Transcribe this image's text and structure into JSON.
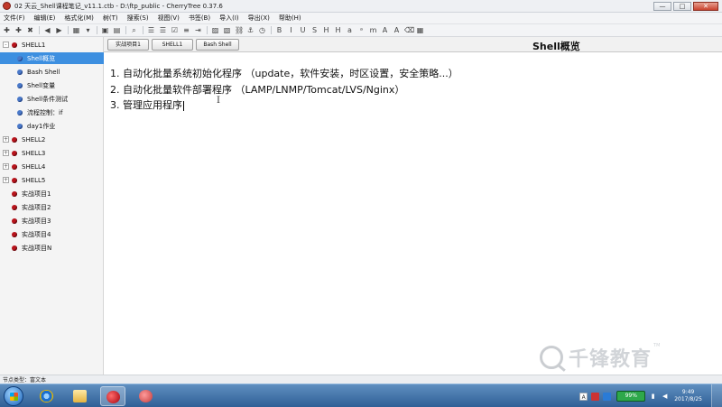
{
  "window": {
    "title": "02 天云_Shell课程笔记_v11.1.ctb - D:\\ftp_public - CherryTree 0.37.6",
    "controls": {
      "minimize": "—",
      "maximize": "□",
      "close": "✕"
    }
  },
  "menu": [
    "文件(F)",
    "编辑(E)",
    "格式化(M)",
    "树(T)",
    "搜索(S)",
    "视图(V)",
    "书签(B)",
    "导入(I)",
    "导出(X)",
    "帮助(H)"
  ],
  "tree": {
    "items": [
      {
        "label": "SHELL1",
        "level": 0,
        "expander": "-",
        "dot": "red"
      },
      {
        "label": "Shell概览",
        "level": 1,
        "dot": "blue",
        "selected": true
      },
      {
        "label": "Bash Shell",
        "level": 1,
        "dot": "blue"
      },
      {
        "label": "Shell变量",
        "level": 1,
        "dot": "blue"
      },
      {
        "label": "Shell条件测试",
        "level": 1,
        "dot": "blue"
      },
      {
        "label": "流程控制：if",
        "level": 1,
        "dot": "blue"
      },
      {
        "label": "day1作业",
        "level": 1,
        "dot": "blue"
      },
      {
        "label": "SHELL2",
        "level": 0,
        "expander": "+",
        "dot": "red"
      },
      {
        "label": "SHELL3",
        "level": 0,
        "expander": "+",
        "dot": "red"
      },
      {
        "label": "SHELL4",
        "level": 0,
        "expander": "+",
        "dot": "red"
      },
      {
        "label": "SHELL5",
        "level": 0,
        "expander": "+",
        "dot": "red"
      },
      {
        "label": "实战项目1",
        "level": 0,
        "dot": "red"
      },
      {
        "label": "实战项目2",
        "level": 0,
        "dot": "red"
      },
      {
        "label": "实战项目3",
        "level": 0,
        "dot": "red"
      },
      {
        "label": "实战项目4",
        "level": 0,
        "dot": "red"
      },
      {
        "label": "实战项目N",
        "level": 0,
        "dot": "red"
      }
    ]
  },
  "tabs": [
    "实战项目1",
    "SHELL1",
    "Bash Shell"
  ],
  "node_title": "Shell概览",
  "editor": {
    "lines": [
      "1. 自动化批量系统初始化程序 （update，软件安装，时区设置，安全策略...）",
      "2. 自动化批量软件部署程序 （LAMP/LNMP/Tomcat/LVS/Nginx）",
      "3. 管理应用程序"
    ],
    "cursor_glyph": "I"
  },
  "watermark": {
    "text": "千锋教育",
    "tm": "TM"
  },
  "status": {
    "node_type": "节点类型：富文本"
  },
  "taskbar": {
    "battery": "99%",
    "ime": "A",
    "clock_time": "9:49",
    "clock_date": "2017/8/25"
  },
  "colors": {
    "selected": "#3d8fe0",
    "node_dot_red": "#b8141c",
    "node_dot_blue": "#4a79c9",
    "taskbar": "#2f5f96"
  }
}
